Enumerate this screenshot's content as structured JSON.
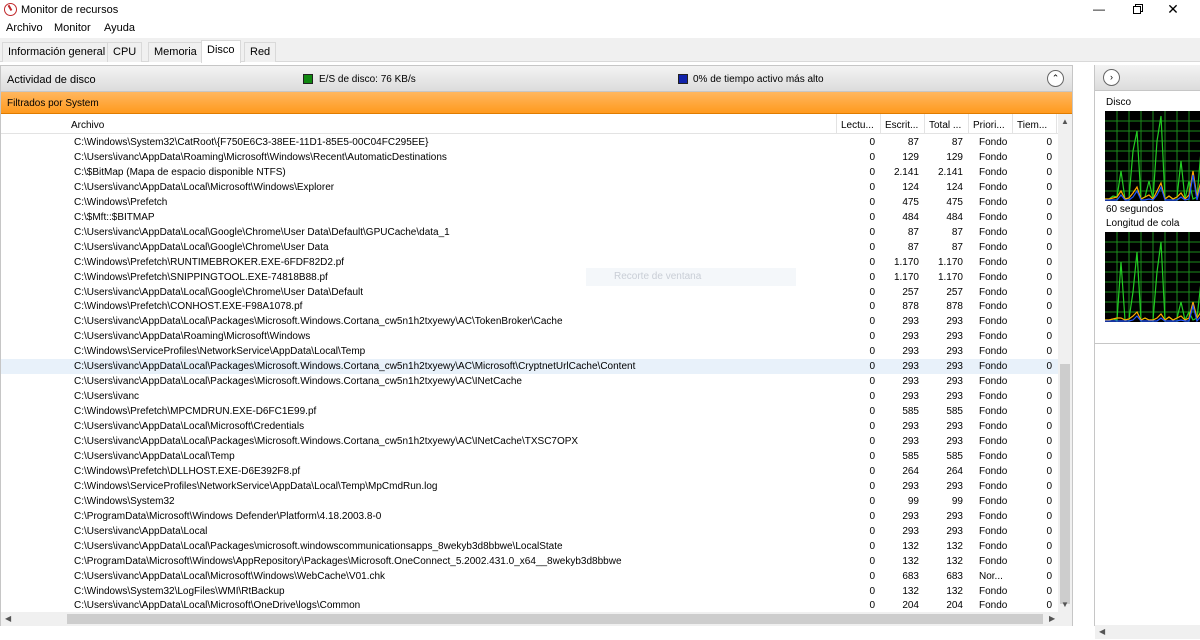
{
  "window": {
    "title": "Monitor de recursos",
    "minimize": "—",
    "close": "✕"
  },
  "menu": [
    "Archivo",
    "Monitor",
    "Ayuda"
  ],
  "tabs": [
    {
      "label": "Información general",
      "active": false
    },
    {
      "label": "CPU",
      "active": false
    },
    {
      "label": "Memoria",
      "active": false
    },
    {
      "label": "Disco",
      "active": true
    },
    {
      "label": "Red",
      "active": false
    }
  ],
  "disk_section": {
    "title": "Actividad de disco",
    "io_label": "E/S de disco: 76 KB/s",
    "io_color": "#118811",
    "active_label": "0% de tiempo activo más alto",
    "active_color": "#1122aa",
    "collapse_glyph": "⌃"
  },
  "filter": {
    "label": "Filtrados por System",
    "color": "#ffa53a"
  },
  "tooltip_ghost": "Recorte de ventana",
  "table": {
    "columns": [
      "Archivo",
      "Lectu...",
      "Escrit...",
      "Total ...",
      "Priori...",
      "Tiem..."
    ],
    "rows": [
      [
        "C:\\Windows\\System32\\CatRoot\\{F750E6C3-38EE-11D1-85E5-00C04FC295EE}",
        "0",
        "87",
        "87",
        "Fondo",
        "0"
      ],
      [
        "C:\\Users\\ivanc\\AppData\\Roaming\\Microsoft\\Windows\\Recent\\AutomaticDestinations",
        "0",
        "129",
        "129",
        "Fondo",
        "0"
      ],
      [
        "C:\\$BitMap (Mapa de espacio disponible NTFS)",
        "0",
        "2.141",
        "2.141",
        "Fondo",
        "0"
      ],
      [
        "C:\\Users\\ivanc\\AppData\\Local\\Microsoft\\Windows\\Explorer",
        "0",
        "124",
        "124",
        "Fondo",
        "0"
      ],
      [
        "C:\\Windows\\Prefetch",
        "0",
        "475",
        "475",
        "Fondo",
        "0"
      ],
      [
        "C:\\$Mft::$BITMAP",
        "0",
        "484",
        "484",
        "Fondo",
        "0"
      ],
      [
        "C:\\Users\\ivanc\\AppData\\Local\\Google\\Chrome\\User Data\\Default\\GPUCache\\data_1",
        "0",
        "87",
        "87",
        "Fondo",
        "0"
      ],
      [
        "C:\\Users\\ivanc\\AppData\\Local\\Google\\Chrome\\User Data",
        "0",
        "87",
        "87",
        "Fondo",
        "0"
      ],
      [
        "C:\\Windows\\Prefetch\\RUNTIMEBROKER.EXE-6FDF82D2.pf",
        "0",
        "1.170",
        "1.170",
        "Fondo",
        "0"
      ],
      [
        "C:\\Windows\\Prefetch\\SNIPPINGTOOL.EXE-74818B88.pf",
        "0",
        "1.170",
        "1.170",
        "Fondo",
        "0"
      ],
      [
        "C:\\Users\\ivanc\\AppData\\Local\\Google\\Chrome\\User Data\\Default",
        "0",
        "257",
        "257",
        "Fondo",
        "0"
      ],
      [
        "C:\\Windows\\Prefetch\\CONHOST.EXE-F98A1078.pf",
        "0",
        "878",
        "878",
        "Fondo",
        "0"
      ],
      [
        "C:\\Users\\ivanc\\AppData\\Local\\Packages\\Microsoft.Windows.Cortana_cw5n1h2txyewy\\AC\\TokenBroker\\Cache",
        "0",
        "293",
        "293",
        "Fondo",
        "0"
      ],
      [
        "C:\\Users\\ivanc\\AppData\\Roaming\\Microsoft\\Windows",
        "0",
        "293",
        "293",
        "Fondo",
        "0"
      ],
      [
        "C:\\Windows\\ServiceProfiles\\NetworkService\\AppData\\Local\\Temp",
        "0",
        "293",
        "293",
        "Fondo",
        "0"
      ],
      [
        "C:\\Users\\ivanc\\AppData\\Local\\Packages\\Microsoft.Windows.Cortana_cw5n1h2txyewy\\AC\\Microsoft\\CryptnetUrlCache\\Content",
        "0",
        "293",
        "293",
        "Fondo",
        "0"
      ],
      [
        "C:\\Users\\ivanc\\AppData\\Local\\Packages\\Microsoft.Windows.Cortana_cw5n1h2txyewy\\AC\\INetCache",
        "0",
        "293",
        "293",
        "Fondo",
        "0"
      ],
      [
        "C:\\Users\\ivanc",
        "0",
        "293",
        "293",
        "Fondo",
        "0"
      ],
      [
        "C:\\Windows\\Prefetch\\MPCMDRUN.EXE-D6FC1E99.pf",
        "0",
        "585",
        "585",
        "Fondo",
        "0"
      ],
      [
        "C:\\Users\\ivanc\\AppData\\Local\\Microsoft\\Credentials",
        "0",
        "293",
        "293",
        "Fondo",
        "0"
      ],
      [
        "C:\\Users\\ivanc\\AppData\\Local\\Packages\\Microsoft.Windows.Cortana_cw5n1h2txyewy\\AC\\INetCache\\TXSC7OPX",
        "0",
        "293",
        "293",
        "Fondo",
        "0"
      ],
      [
        "C:\\Users\\ivanc\\AppData\\Local\\Temp",
        "0",
        "585",
        "585",
        "Fondo",
        "0"
      ],
      [
        "C:\\Windows\\Prefetch\\DLLHOST.EXE-D6E392F8.pf",
        "0",
        "264",
        "264",
        "Fondo",
        "0"
      ],
      [
        "C:\\Windows\\ServiceProfiles\\NetworkService\\AppData\\Local\\Temp\\MpCmdRun.log",
        "0",
        "293",
        "293",
        "Fondo",
        "0"
      ],
      [
        "C:\\Windows\\System32",
        "0",
        "99",
        "99",
        "Fondo",
        "0"
      ],
      [
        "C:\\ProgramData\\Microsoft\\Windows Defender\\Platform\\4.18.2003.8-0",
        "0",
        "293",
        "293",
        "Fondo",
        "0"
      ],
      [
        "C:\\Users\\ivanc\\AppData\\Local",
        "0",
        "293",
        "293",
        "Fondo",
        "0"
      ],
      [
        "C:\\Users\\ivanc\\AppData\\Local\\Packages\\microsoft.windowscommunicationsapps_8wekyb3d8bbwe\\LocalState",
        "0",
        "132",
        "132",
        "Fondo",
        "0"
      ],
      [
        "C:\\ProgramData\\Microsoft\\Windows\\AppRepository\\Packages\\Microsoft.OneConnect_5.2002.431.0_x64__8wekyb3d8bbwe",
        "0",
        "132",
        "132",
        "Fondo",
        "0"
      ],
      [
        "C:\\Users\\ivanc\\AppData\\Local\\Microsoft\\Windows\\WebCache\\V01.chk",
        "0",
        "683",
        "683",
        "Nor...",
        "0"
      ],
      [
        "C:\\Windows\\System32\\LogFiles\\WMI\\RtBackup",
        "0",
        "132",
        "132",
        "Fondo",
        "0"
      ],
      [
        "C:\\Users\\ivanc\\AppData\\Local\\Microsoft\\OneDrive\\logs\\Common",
        "0",
        "204",
        "204",
        "Fondo",
        "0"
      ]
    ],
    "selected_row": 15
  },
  "graphs": {
    "disk_label": "Disco",
    "time_label": "60 segundos",
    "queue_label": "Longitud de cola",
    "expand_glyph": "›",
    "grid_color": "#1c8a1c",
    "line_color_1": "#22cc22",
    "line_color_2": "#2255ff",
    "line_color_3": "#ffaa00"
  },
  "scroll": {
    "up": "▲",
    "down": "▼",
    "left": "◀",
    "right": "▶"
  }
}
